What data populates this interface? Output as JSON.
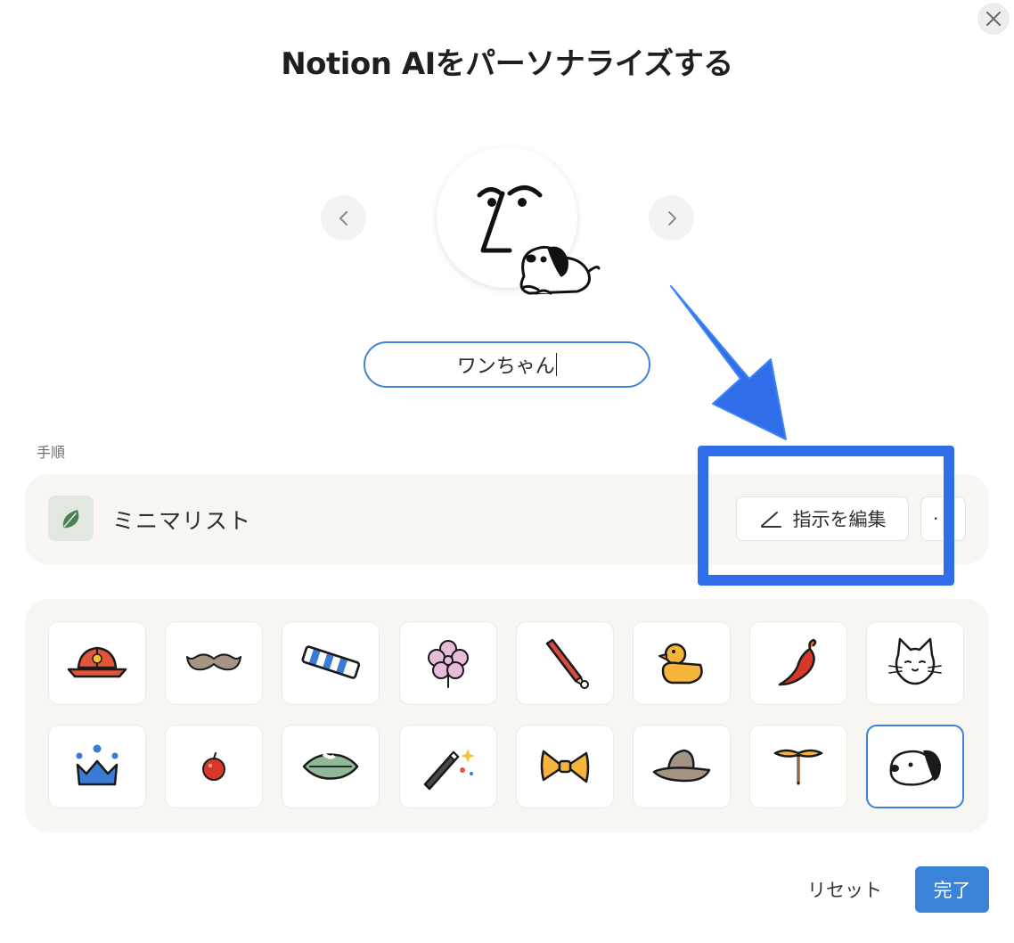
{
  "dialog": {
    "title": "Notion AIをパーソナライズする",
    "close_icon": "close-icon"
  },
  "avatar": {
    "name_value": "ワンちゃん",
    "face_icon": "line-art-face-icon",
    "accessory_icon": "dog-icon",
    "prev_icon": "chevron-left-icon",
    "next_icon": "chevron-right-icon"
  },
  "instructions": {
    "section_label": "手順",
    "preset_name": "ミニマリスト",
    "preset_icon": "leaf-icon",
    "edit_label": "指示を編集",
    "edit_icon": "pencil-icon",
    "more_label": "··"
  },
  "annotation": {
    "color": "#2f6ee8"
  },
  "accessories": {
    "selected": "dog",
    "items": [
      {
        "id": "hard-hat",
        "icon": "hard-hat-icon"
      },
      {
        "id": "mustache",
        "icon": "mustache-icon"
      },
      {
        "id": "striped-scarf",
        "icon": "striped-scarf-icon"
      },
      {
        "id": "flower",
        "icon": "flower-icon"
      },
      {
        "id": "pencil",
        "icon": "pencil-icon"
      },
      {
        "id": "rubber-duck",
        "icon": "rubber-duck-icon"
      },
      {
        "id": "chili-pepper",
        "icon": "chili-pepper-icon"
      },
      {
        "id": "cat",
        "icon": "cat-icon"
      },
      {
        "id": "crown",
        "icon": "crown-icon"
      },
      {
        "id": "apple",
        "icon": "apple-icon"
      },
      {
        "id": "leaf",
        "icon": "leaf-icon"
      },
      {
        "id": "magic-wand",
        "icon": "magic-wand-icon"
      },
      {
        "id": "bow-tie",
        "icon": "bow-tie-icon"
      },
      {
        "id": "hat",
        "icon": "hat-icon"
      },
      {
        "id": "propeller",
        "icon": "propeller-icon"
      },
      {
        "id": "dog",
        "icon": "dog-icon"
      }
    ]
  },
  "footer": {
    "reset_label": "リセット",
    "done_label": "完了"
  },
  "colors": {
    "accent": "#3b82d9",
    "panel_background": "#f7f6f3"
  }
}
